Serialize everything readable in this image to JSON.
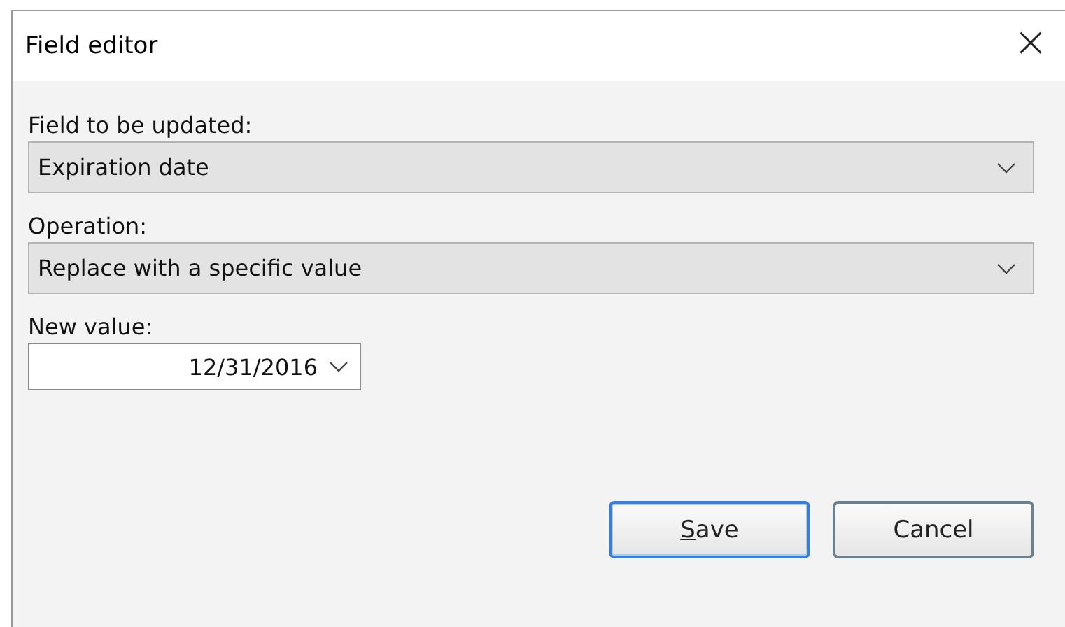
{
  "window": {
    "title": "Field editor",
    "close": "×"
  },
  "fields": [
    {
      "label": "Field to be updated:",
      "kind": "dropdown",
      "value": "Expiration date"
    },
    {
      "label": "Operation:",
      "kind": "dropdown",
      "value": "Replace with a specific value"
    },
    {
      "label": "New value:",
      "kind": "date",
      "value": "12/31/2016"
    }
  ],
  "buttons": [
    {
      "label": "Save",
      "default": true
    },
    {
      "label": "Cancel",
      "default": false
    }
  ]
}
